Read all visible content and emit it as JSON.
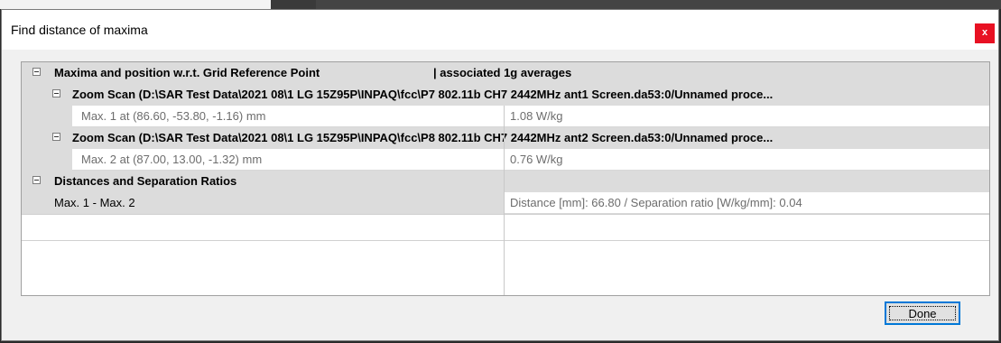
{
  "dialog": {
    "title": "Find distance of maxima",
    "close_label": "x",
    "done_label": "Done"
  },
  "tree": {
    "root": {
      "label": "Maxima and position w.r.t. Grid Reference Point",
      "right_label": "|   associated 1g averages",
      "toggle": "minus-box-icon"
    },
    "scans": [
      {
        "label": "Zoom Scan (D:\\SAR Test Data\\2021 08\\1 LG 15Z95P\\INPAQ\\fcc\\P7 802.11b CH7 2442MHz ant1 Screen.da53:0/Unnamed proce...",
        "max_label": "Max. 1 at (86.60, -53.80, -1.16) mm",
        "max_value": "1.08 W/kg"
      },
      {
        "label": "Zoom Scan (D:\\SAR Test Data\\2021 08\\1 LG 15Z95P\\INPAQ\\fcc\\P8 802.11b CH7 2442MHz ant2 Screen.da53:0/Unnamed proce...",
        "max_label": "Max. 2 at (87.00, 13.00, -1.32) mm",
        "max_value": "0.76 W/kg"
      }
    ],
    "distances": {
      "label": "Distances and Separation Ratios",
      "row_label": "Max. 1 - Max. 2",
      "row_value": "Distance [mm]: 66.80 / Separation ratio [W/kg/mm]: 0.04"
    }
  },
  "colors": {
    "close_button": "#e81123",
    "focus_border": "#0078d7",
    "group_row": "#dcdcdc"
  }
}
